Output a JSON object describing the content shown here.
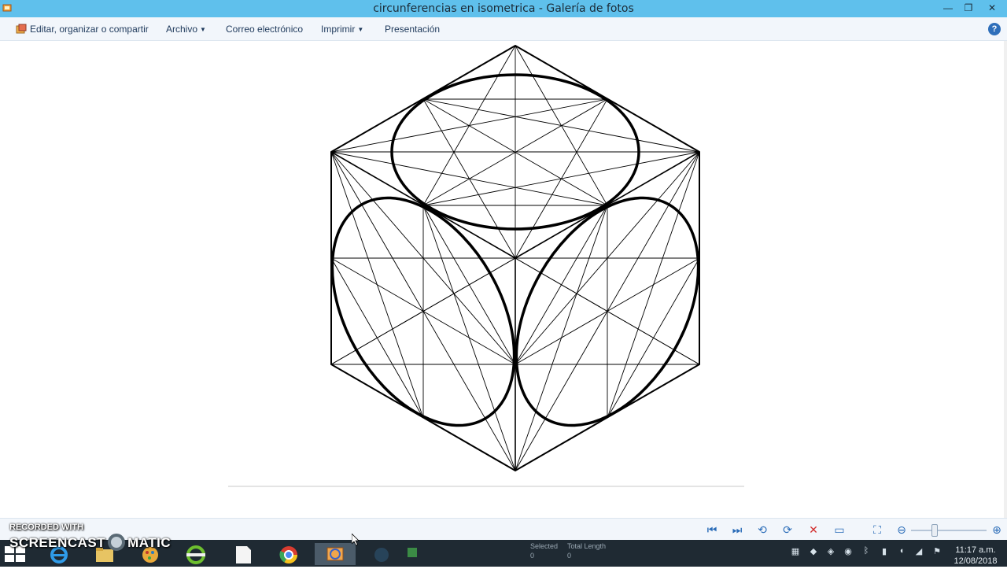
{
  "window": {
    "title": "circunferencias en isometrica - Galería de fotos",
    "controls": {
      "minimize": "—",
      "restore": "❐",
      "close": "✕"
    }
  },
  "menubar": {
    "items": [
      {
        "label": "Editar, organizar o compartir",
        "icon": "organize-icon",
        "dropdown": false
      },
      {
        "label": "Archivo",
        "dropdown": true
      },
      {
        "label": "Correo electrónico",
        "dropdown": false
      },
      {
        "label": "Imprimir",
        "dropdown": true
      },
      {
        "label": "Presentación",
        "dropdown": false
      }
    ],
    "help": "?"
  },
  "viewer": {
    "image": "isometric-cube-circles-drawing",
    "colors": {
      "background": "#ffffff",
      "ink": "#000000"
    }
  },
  "controls": {
    "buttons": [
      {
        "name": "previous-icon",
        "glyph": "⏮"
      },
      {
        "name": "next-icon",
        "glyph": "⏭"
      },
      {
        "name": "rotate-left-icon",
        "glyph": "⟲"
      },
      {
        "name": "rotate-right-icon",
        "glyph": "⟳"
      },
      {
        "name": "delete-icon",
        "glyph": "✕"
      },
      {
        "name": "slideshow-icon",
        "glyph": "▭"
      },
      {
        "name": "actual-size-icon",
        "glyph": "⛶"
      },
      {
        "name": "zoom-out-icon",
        "glyph": "⊖"
      },
      {
        "name": "zoom-in-icon",
        "glyph": "⊕"
      }
    ]
  },
  "taskbar": {
    "cad_status": {
      "selected_label": "Selected",
      "selected_value": "0",
      "total_label": "Total Length",
      "total_value": "0"
    },
    "clock": {
      "time": "11:17 a.m.",
      "date": "12/08/2018"
    },
    "colors": {
      "background": "#1f2a33",
      "titlebar": "#5fc0ec"
    }
  },
  "watermark": {
    "line1": "RECORDED WITH",
    "line2a": "SCREENCAST",
    "line2b": "MATIC"
  }
}
